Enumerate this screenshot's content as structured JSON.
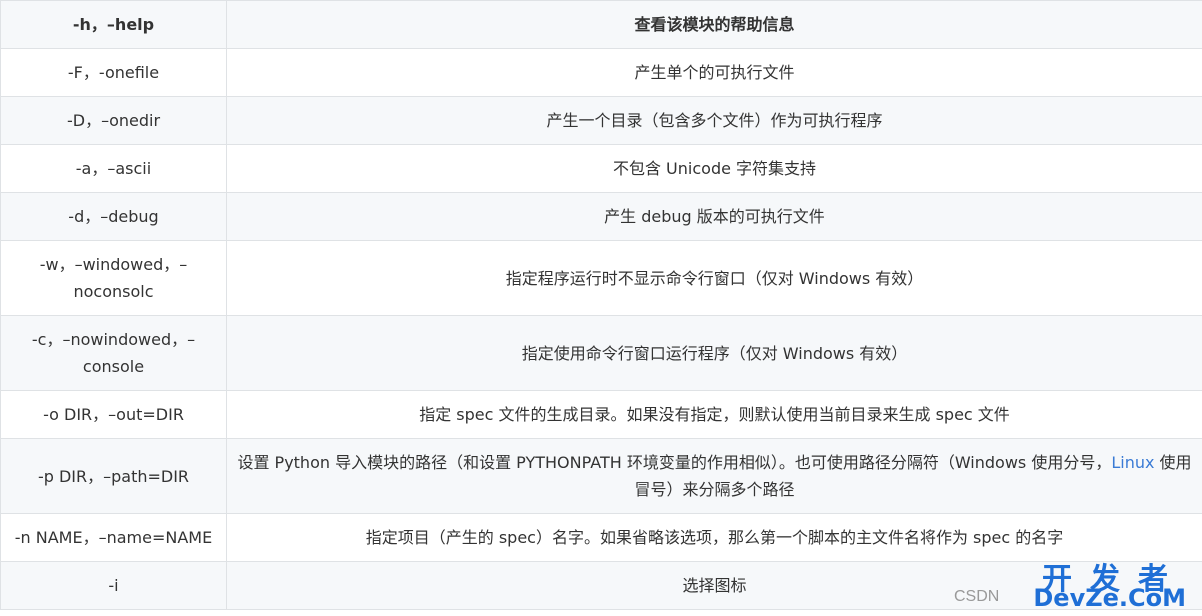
{
  "table": {
    "header": {
      "option": "-h，–help",
      "description": "查看该模块的帮助信息"
    },
    "rows": [
      {
        "option": "-F，-onefile",
        "description": "产生单个的可执行文件"
      },
      {
        "option": "-D，–onedir",
        "description": "产生一个目录（包含多个文件）作为可执行程序"
      },
      {
        "option": "-a，–ascii",
        "description": "不包含 Unicode 字符集支持"
      },
      {
        "option": "-d，–debug",
        "description": "产生 debug 版本的可执行文件"
      },
      {
        "option": "-w，–windowed，–noconsolc",
        "description": "指定程序运行时不显示命令行窗口（仅对 Windows 有效）"
      },
      {
        "option": "-c，–nowindowed，–console",
        "description": "指定使用命令行窗口运行程序（仅对 Windows 有效）"
      },
      {
        "option": "-o DIR，–out=DIR",
        "description": "指定 spec 文件的生成目录。如果没有指定，则默认使用当前目录来生成 spec 文件"
      },
      {
        "option": "-p DIR，–path=DIR",
        "description_before": "设置 Python 导入模块的路径（和设置 PYTHONPATH 环境变量的作用相似）。也可使用路径分隔符（Windows 使用分号，",
        "description_link": "Linux",
        "description_after": " 使用冒号）来分隔多个路径"
      },
      {
        "option": "-n NAME，–name=NAME",
        "description": "指定项目（产生的 spec）名字。如果省略该选项，那么第一个脚本的主文件名将作为 spec 的名字"
      },
      {
        "option": "-i",
        "description": "选择图标"
      }
    ]
  },
  "watermark": {
    "chinese": "开发者",
    "english": "DevZe.CoM",
    "source": "CSDN"
  },
  "colors": {
    "header_bg": "#f6f8fa",
    "border": "#dfe2e5",
    "link": "#3a7bd5",
    "watermark": "#1f6fd6"
  }
}
